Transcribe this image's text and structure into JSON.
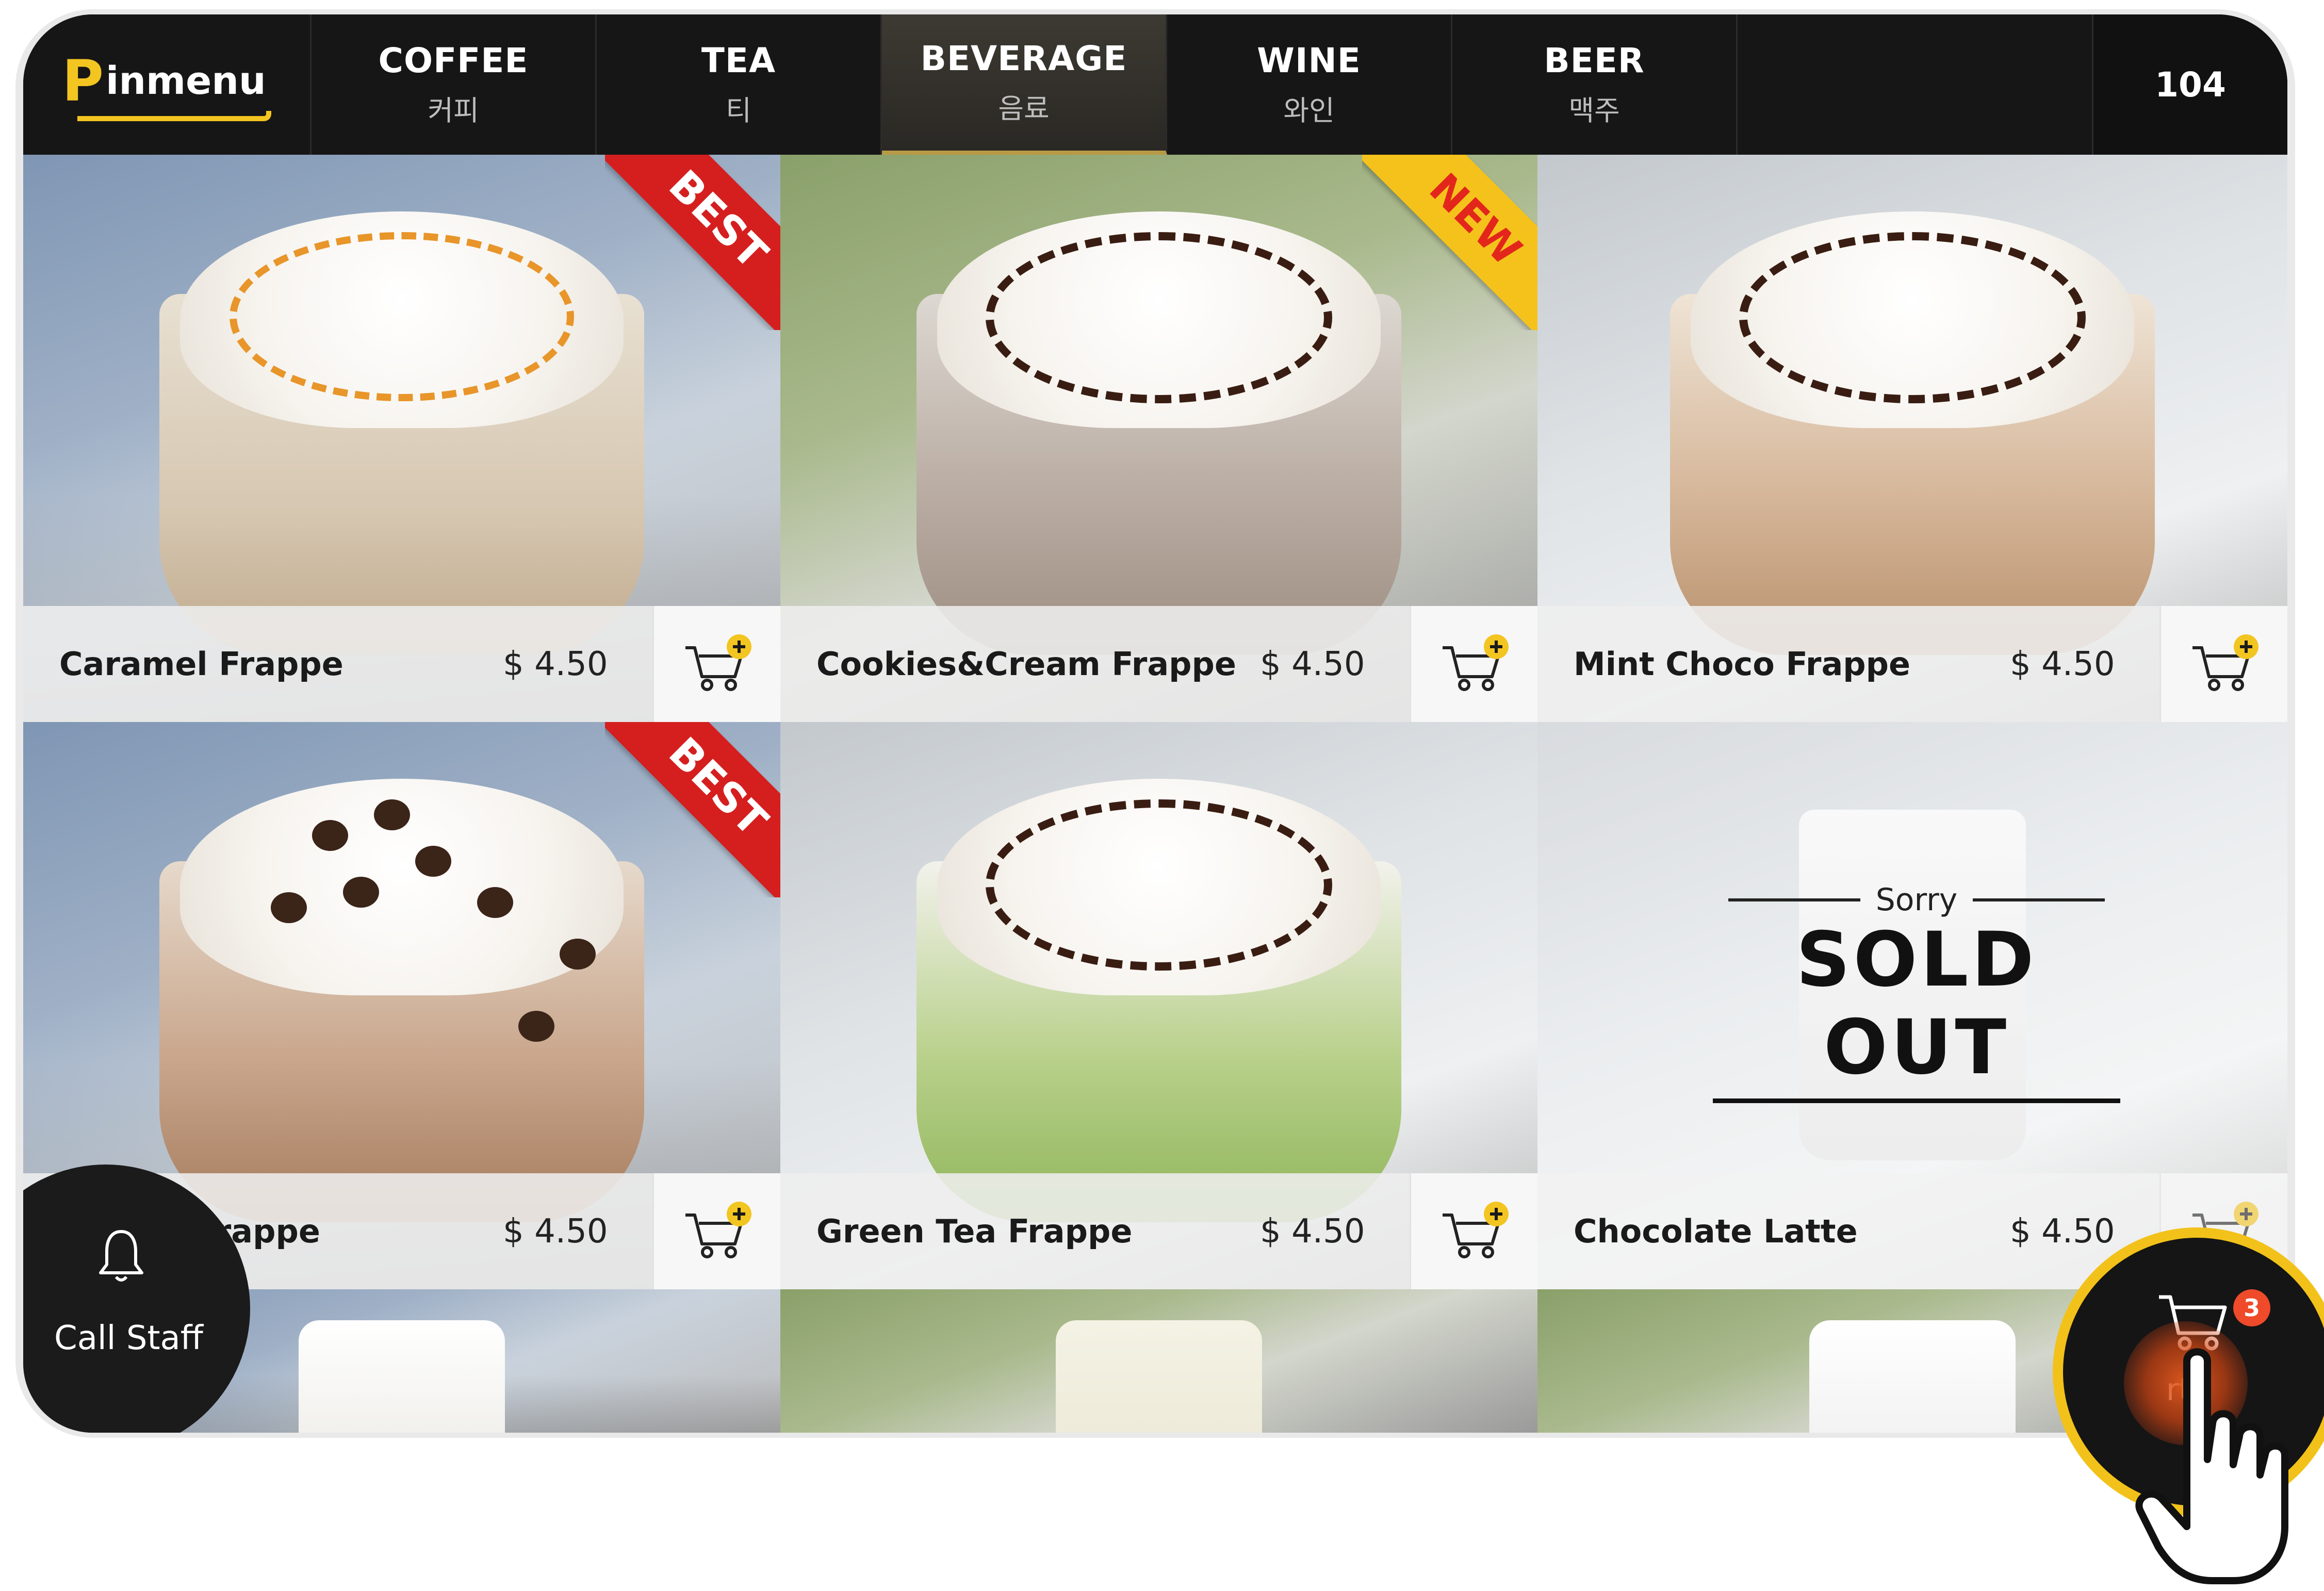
{
  "app": {
    "logo_text": "inmenu",
    "logo_letter": "P",
    "table_number": "104"
  },
  "nav": {
    "tabs": [
      {
        "en": "COFFEE",
        "ko": "커피",
        "active": false
      },
      {
        "en": "TEA",
        "ko": "티",
        "active": false
      },
      {
        "en": "BEVERAGE",
        "ko": "음료",
        "active": true
      },
      {
        "en": "WINE",
        "ko": "와인",
        "active": false
      },
      {
        "en": "BEER",
        "ko": "맥주",
        "active": false
      }
    ]
  },
  "products": [
    {
      "name": "Caramel Frappe",
      "price": "$ 4.50",
      "badge": "BEST"
    },
    {
      "name": "Cookies&Cream Frappe",
      "price": "$ 4.50",
      "badge": "NEW"
    },
    {
      "name": "Mint Choco Frappe",
      "price": "$ 4.50",
      "badge": ""
    },
    {
      "name": "cha Frappe",
      "price": "$ 4.50",
      "badge": "BEST"
    },
    {
      "name": "Green Tea Frappe",
      "price": "$ 4.50",
      "badge": ""
    },
    {
      "name": "Chocolate Latte",
      "price": "$ 4.50",
      "badge": "",
      "sold_out": true
    }
  ],
  "sold_out": {
    "sorry": "Sorry",
    "label": "SOLD OUT"
  },
  "controls": {
    "call_staff_label": "Call Staff",
    "cart_label": "rt",
    "cart_count": "3"
  },
  "colors": {
    "accent_yellow": "#f3c520",
    "best_red": "#d51f1f",
    "new_yellow": "#f5c21b",
    "badge_red": "#ef4a2a",
    "topbar": "#161616"
  },
  "icons": {
    "cart_add": "shopping-cart-plus-icon",
    "bell": "bell-icon",
    "cart": "shopping-cart-icon",
    "pointer": "pointing-hand-icon"
  }
}
